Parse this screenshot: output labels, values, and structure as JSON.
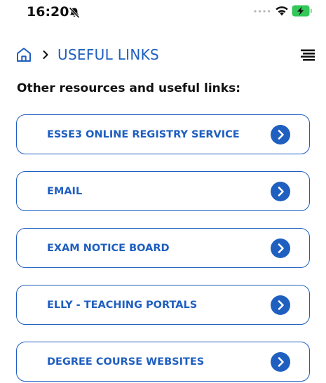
{
  "status_bar": {
    "time": "16:20"
  },
  "header": {
    "breadcrumb_label": "USEFUL LINKS"
  },
  "section": {
    "title": "Other resources and useful links:"
  },
  "links": [
    {
      "label": "ESSE3 ONLINE REGISTRY SERVICE"
    },
    {
      "label": "EMAIL"
    },
    {
      "label": "EXAM NOTICE BOARD"
    },
    {
      "label": "ELLY - TEACHING PORTALS"
    },
    {
      "label": "DEGREE COURSE WEBSITES"
    }
  ],
  "colors": {
    "accent": "#1f5fbf",
    "text": "#111111",
    "background": "#ffffff",
    "battery": "#34c759"
  },
  "icons": {
    "status": [
      "bell-slash-icon",
      "signal-dots-icon",
      "wifi-icon",
      "battery-charging-icon"
    ],
    "header": [
      "home-icon",
      "chevron-right-icon",
      "hamburger-menu-icon"
    ],
    "link_arrow": "chevron-right-circle-icon"
  }
}
